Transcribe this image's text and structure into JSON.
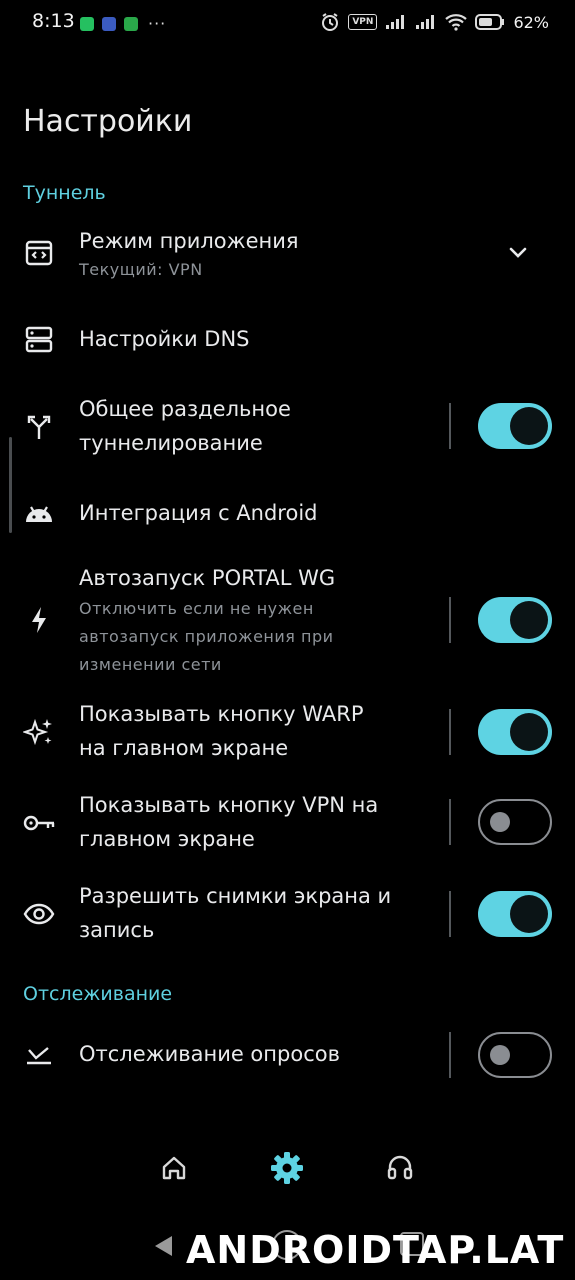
{
  "status_bar": {
    "time": "8:13",
    "dots": "···",
    "vpn_label": "VPN",
    "battery": "62%"
  },
  "page": {
    "title": "Настройки"
  },
  "sections": {
    "tunnel": "Туннель",
    "tracking": "Отслеживание"
  },
  "rows": {
    "app_mode": {
      "title": "Режим приложения",
      "subtitle": "Текущий: VPN",
      "icon": "app-window-icon"
    },
    "dns": {
      "title": "Настройки DNS",
      "icon": "dns-server-icon"
    },
    "split_tunnel": {
      "title_line1": "Общее раздельное",
      "title_line2": "туннелирование",
      "enabled": true,
      "icon": "split-arrows-icon"
    },
    "android": {
      "title": "Интеграция с Android",
      "icon": "android-icon"
    },
    "autostart": {
      "title": "Автозапуск PORTAL WG",
      "sub_line1": "Отключить если не нужен",
      "sub_line2": "автозапуск приложения при",
      "sub_line3": "изменении сети",
      "enabled": true,
      "icon": "bolt-icon"
    },
    "warp_button": {
      "title_line1": "Показывать кнопку WARP",
      "title_line2": "на главном экране",
      "enabled": true,
      "icon": "sparkles-icon"
    },
    "vpn_button": {
      "title_line1": "Показывать кнопку VPN на",
      "title_line2": "главном экране",
      "enabled": false,
      "icon": "key-icon"
    },
    "screenshots": {
      "title_line1": "Разрешить снимки экрана и",
      "title_line2": "запись",
      "enabled": true,
      "icon": "eye-icon"
    },
    "poll_tracking": {
      "title": "Отслеживание опросов",
      "enabled": false,
      "icon": "poll-check-icon"
    }
  },
  "bottom_nav": [
    "home-icon",
    "settings-icon",
    "headset-icon"
  ],
  "watermark": "ANDROIDTAP.LAT",
  "colors": {
    "accent": "#5ed3e3",
    "background": "#000000",
    "text": "#e9eaec",
    "secondary": "#8e9399"
  }
}
